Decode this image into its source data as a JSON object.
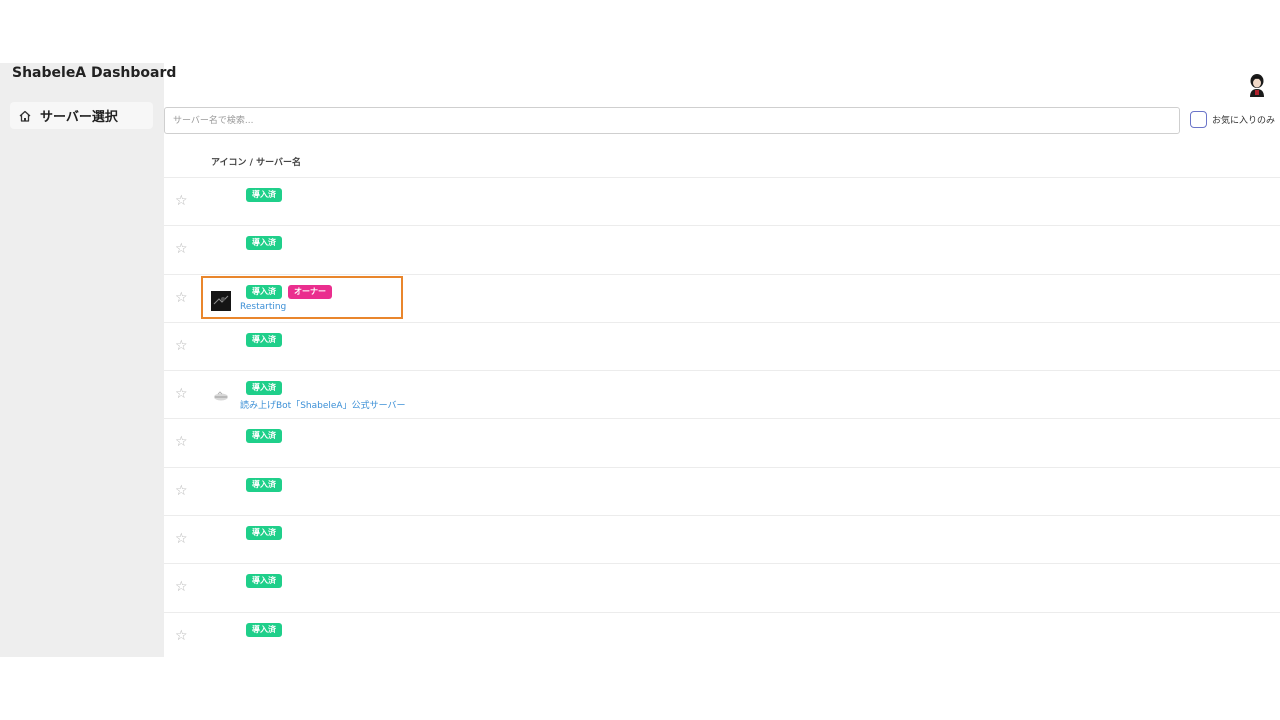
{
  "app": {
    "title": "ShabeleA Dashboard"
  },
  "sidebar": {
    "items": [
      {
        "label": "サーバー選択",
        "icon": "home-icon"
      }
    ]
  },
  "search": {
    "placeholder": "サーバー名で検索...",
    "value": ""
  },
  "filter": {
    "favorites_only_label": "お気に入りのみ",
    "checked": false
  },
  "table": {
    "column_header": "アイコン / サーバー名",
    "rows": [
      {
        "installed": "導入済",
        "owner": "",
        "name": "",
        "icon": ""
      },
      {
        "installed": "導入済",
        "owner": "",
        "name": "",
        "icon": ""
      },
      {
        "installed": "導入済",
        "owner": "オーナー",
        "name": "Restarting",
        "icon": "server-icon-dark"
      },
      {
        "installed": "導入済",
        "owner": "",
        "name": "",
        "icon": ""
      },
      {
        "installed": "導入済",
        "owner": "",
        "name": "読み上げBot「ShabeleA」公式サーバー",
        "icon": "server-icon-light"
      },
      {
        "installed": "導入済",
        "owner": "",
        "name": "",
        "icon": ""
      },
      {
        "installed": "導入済",
        "owner": "",
        "name": "",
        "icon": ""
      },
      {
        "installed": "導入済",
        "owner": "",
        "name": "",
        "icon": ""
      },
      {
        "installed": "導入済",
        "owner": "",
        "name": "",
        "icon": ""
      },
      {
        "installed": "導入済",
        "owner": "",
        "name": "",
        "icon": ""
      }
    ]
  },
  "colors": {
    "installed_badge": "#1fcf8a",
    "owner_badge": "#ea2e8e",
    "link": "#3b8fd6",
    "highlight": "#e9862c",
    "sidebar_bg": "#eeeeee"
  }
}
